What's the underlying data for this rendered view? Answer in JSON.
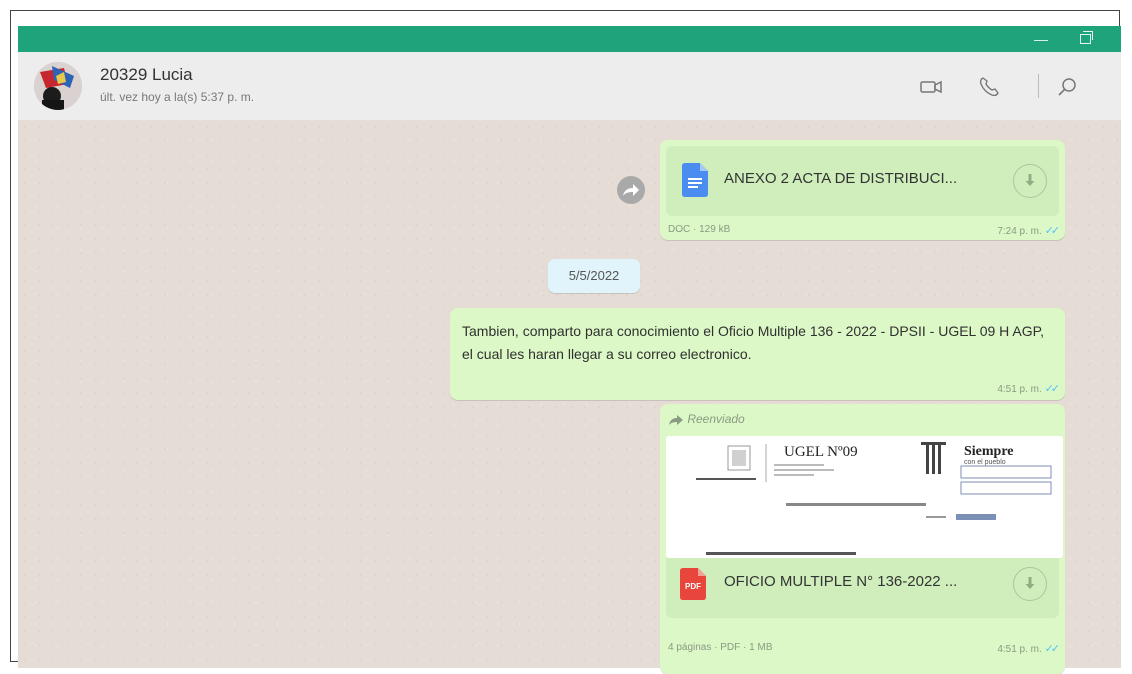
{
  "window": {
    "minimize_glyph": "—"
  },
  "header": {
    "contact_name": "20329 Lucia",
    "status": "últ. vez hoy a la(s) 5:37 p. m.",
    "icons": [
      "video-call-icon",
      "voice-call-icon",
      "search-icon"
    ]
  },
  "colors": {
    "titlebar": "#1fa37a",
    "outgoing_bubble": "#dcf8c6",
    "chat_bg": "#e5ddd5",
    "ticks": "#4fc3f7"
  },
  "messages": [
    {
      "type": "document",
      "file_name": "ANEXO 2 ACTA DE DISTRIBUCI...",
      "file_meta": "DOC · 129 kB",
      "time": "7:24 p. m."
    },
    {
      "type": "date",
      "date": "5/5/2022"
    },
    {
      "type": "text",
      "text": "Tambien, comparto  para conocimiento el Oficio Multiple 136 - 2022 - DPSII - UGEL  09 H AGP,  el  cual les haran llegar a su  correo electronico.",
      "time": "4:51 p. m."
    },
    {
      "type": "document-pdf",
      "forwarded_label": "Reenviado",
      "preview": {
        "org": "UGEL Nº09",
        "slogan_top": "Siempre",
        "slogan_bottom": "con el pueblo"
      },
      "file_icon_label": "PDF",
      "file_name": "OFICIO MULTIPLE N° 136-2022 ...",
      "file_meta": "4 páginas · PDF · 1 MB",
      "time": "4:51 p. m."
    }
  ]
}
